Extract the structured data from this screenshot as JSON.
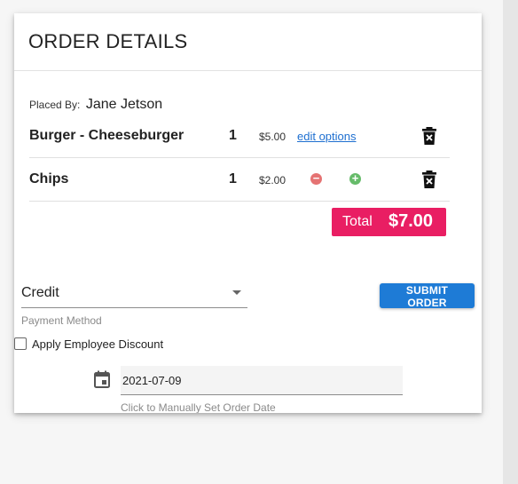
{
  "order": {
    "title": "ORDER DETAILS",
    "placed_by_label": "Placed By:",
    "placed_by_name": "Jane Jetson",
    "items": [
      {
        "name": "Burger - Cheeseburger",
        "qty": "1",
        "price": "$5.00",
        "action_label": "edit options"
      },
      {
        "name": "Chips",
        "qty": "1",
        "price": "$2.00"
      }
    ],
    "icons": {
      "remove_item": "trash-icon",
      "decrease": "minus-circle-icon",
      "increase": "plus-circle-icon",
      "date": "calendar-icon"
    },
    "total_label": "Total",
    "total_amount": "$7.00",
    "accent_color": "#e91e63"
  },
  "payment": {
    "selected": "Credit",
    "helper": "Payment Method"
  },
  "submit_label": "SUBMIT ORDER",
  "submit_color": "#1e7bd6",
  "discount": {
    "label": "Apply Employee Discount",
    "checked": false
  },
  "order_date": {
    "value": "2021-07-09",
    "helper": "Click to Manually Set Order Date"
  }
}
